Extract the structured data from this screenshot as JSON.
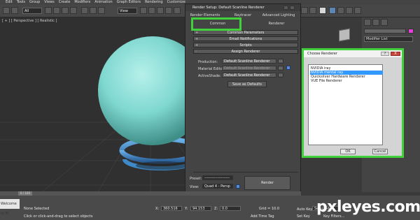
{
  "menubar": [
    "Edit",
    "Tools",
    "Group",
    "Views",
    "Create",
    "Modifiers",
    "Animation",
    "Graph Editors",
    "Rendering",
    "Customize"
  ],
  "toolbar": {
    "selection_filter": "All",
    "ref_coord": "View"
  },
  "viewport": {
    "label": "[ + ] [ Perspective ] [ Realistic ]"
  },
  "render_setup": {
    "title": "Render Setup: Default Scanline Renderer",
    "tabs_top": [
      "Render Elements",
      "Raytracer",
      "Advanced Lighting"
    ],
    "tabs_bottom": [
      "Common",
      "Renderer"
    ],
    "rollouts": [
      "Common Parameters",
      "Email Notifications",
      "Scripts",
      "Assign Renderer"
    ],
    "assign": {
      "production_label": "Production:",
      "production_value": "Default Scanline Renderer",
      "material_label": "Material Editor:",
      "material_value": "Default Scanline Renderer",
      "activeshade_label": "ActiveShade:",
      "activeshade_value": "Default Scanline Renderer",
      "ellipsis": "...",
      "save_defaults": "Save as Defaults"
    },
    "preset_label": "Preset:",
    "preset_value": "--------------------",
    "view_label": "View:",
    "view_value": "Quad 4 - Persp",
    "render_button": "Render"
  },
  "choose_renderer": {
    "title": "Choose Renderer",
    "help": "?",
    "close": "X",
    "items": [
      "NVIDIA iray",
      "NVIDIA mental ray",
      "Quicksilver Hardware Renderer",
      "VUE File Renderer"
    ],
    "selected_index": 1,
    "ok": "OK",
    "cancel": "Cancel"
  },
  "command_panel": {
    "modifier_list": "Modifier List"
  },
  "timeline": {
    "frame": "0 / 100"
  },
  "status": {
    "selection": "None Selected",
    "hint": "Click or click-and-drag to select objects",
    "x_label": "X:",
    "x_value": "360.516",
    "y_label": "Y:",
    "y_value": "94.153",
    "z_label": "Z:",
    "z_value": "0.0",
    "grid": "Grid = 10.0",
    "auto_key": "Auto Key",
    "selected": "Selected",
    "set_key": "Set Key",
    "key_filters": "Key Filters...",
    "add_time_tag": "Add Time Tag",
    "maxscript": "Welcome to M"
  },
  "watermark": "pxleyes.com",
  "colors": {
    "highlight": "#41d13a",
    "sphere": "#7fd8d0",
    "ring": "#3d89c9",
    "selection": "#3399ff"
  }
}
